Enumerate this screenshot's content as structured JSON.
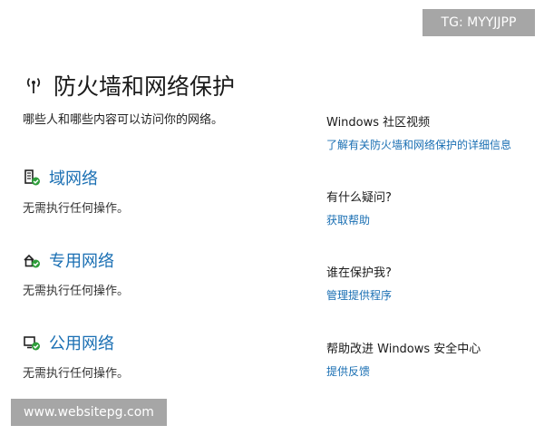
{
  "badge": "TG: MYYJJPP",
  "header": {
    "title": "防火墙和网络保护",
    "icon": "wifi-antenna-icon",
    "subtitle": "哪些人和哪些内容可以访问你的网络。"
  },
  "networks": [
    {
      "label": "域网络",
      "status": "无需执行任何操作。",
      "icon": "domain-network-icon"
    },
    {
      "label": "专用网络",
      "status": "无需执行任何操作。",
      "icon": "private-network-icon"
    },
    {
      "label": "公用网络",
      "status": "无需执行任何操作。",
      "icon": "public-network-icon"
    }
  ],
  "sidebar": [
    {
      "heading": "Windows 社区视频",
      "link": "了解有关防火墙和网络保护的详细信息"
    },
    {
      "heading": "有什么疑问?",
      "link": "获取帮助"
    },
    {
      "heading": "谁在保护我?",
      "link": "管理提供程序"
    },
    {
      "heading": "帮助改进 Windows 安全中心",
      "link": "提供反馈"
    }
  ],
  "watermark": "www.websitepg.com",
  "colors": {
    "link": "#1a6fb3",
    "ok_green": "#2e9d3a",
    "badge_bg": "#a6a6a6"
  }
}
